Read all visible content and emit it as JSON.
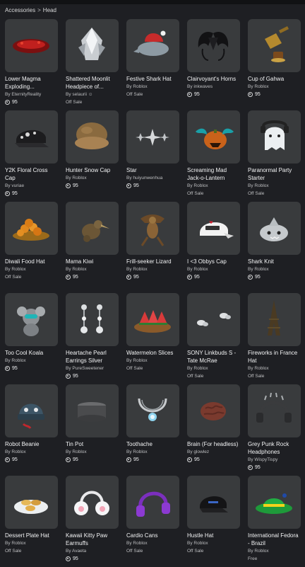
{
  "breadcrumb": {
    "root": "Accessories",
    "separator": ">",
    "current": "Head"
  },
  "items": [
    {
      "name": "Lower Magma Exploding...",
      "creator_prefix": "By",
      "creator": "EternityReality",
      "price": "95",
      "offsale": "",
      "icon": "magma-icon"
    },
    {
      "name": "Shattered Moonlit Headpiece of...",
      "creator_prefix": "By",
      "creator": "selaurii ☺",
      "price": "",
      "offsale": "Off Sale",
      "icon": "crystal-headpiece-icon"
    },
    {
      "name": "Festive Shark Hat",
      "creator_prefix": "By",
      "creator": "Roblox",
      "price": "",
      "offsale": "Off Sale",
      "icon": "shark-hat-icon"
    },
    {
      "name": "Clairvoyant's Horns",
      "creator_prefix": "By",
      "creator": "inkwaves",
      "price": "95",
      "offsale": "",
      "icon": "horns-icon"
    },
    {
      "name": "Cup of Gahwa",
      "creator_prefix": "By",
      "creator": "Roblox",
      "price": "95",
      "offsale": "",
      "icon": "coffee-pot-icon"
    },
    {
      "name": "Y2K Floral Cross Cap",
      "creator_prefix": "By",
      "creator": "vuriae",
      "price": "95",
      "offsale": "",
      "icon": "cap-icon"
    },
    {
      "name": "Hunter Snow Cap",
      "creator_prefix": "By",
      "creator": "Roblox",
      "price": "95",
      "offsale": "",
      "icon": "fur-hat-icon"
    },
    {
      "name": "Star",
      "creator_prefix": "By",
      "creator": "huiyunwenhua",
      "price": "95",
      "offsale": "",
      "icon": "star-icon"
    },
    {
      "name": "Screaming Mad Jack-o-Lantern",
      "creator_prefix": "By",
      "creator": "Roblox",
      "price": "",
      "offsale": "Off Sale",
      "icon": "pumpkin-icon"
    },
    {
      "name": "Paranormal Party Starter",
      "creator_prefix": "By",
      "creator": "Roblox",
      "price": "",
      "offsale": "Off Sale",
      "icon": "ghost-icon"
    },
    {
      "name": "Diwali Food Hat",
      "creator_prefix": "By",
      "creator": "Roblox",
      "price": "",
      "offsale": "Off Sale",
      "icon": "food-plate-icon"
    },
    {
      "name": "Mama Kiwi",
      "creator_prefix": "By",
      "creator": "Roblox",
      "price": "95",
      "offsale": "",
      "icon": "kiwi-bird-icon"
    },
    {
      "name": "Frill-seeker Lizard",
      "creator_prefix": "By",
      "creator": "Roblox",
      "price": "95",
      "offsale": "",
      "icon": "lizard-icon"
    },
    {
      "name": "I <3 Obbys Cap",
      "creator_prefix": "By",
      "creator": "Roblox",
      "price": "95",
      "offsale": "",
      "icon": "obby-cap-icon"
    },
    {
      "name": "Shark Knit",
      "creator_prefix": "By",
      "creator": "Roblox",
      "price": "95",
      "offsale": "",
      "icon": "shark-knit-icon"
    },
    {
      "name": "Too Cool Koala",
      "creator_prefix": "By",
      "creator": "Roblox",
      "price": "95",
      "offsale": "",
      "icon": "koala-icon"
    },
    {
      "name": "Heartache Pearl Earrings Silver",
      "creator_prefix": "By",
      "creator": "PureSweetener",
      "price": "95",
      "offsale": "",
      "icon": "earrings-icon"
    },
    {
      "name": "Watermelon Slices",
      "creator_prefix": "By",
      "creator": "Roblox",
      "price": "",
      "offsale": "Off Sale",
      "icon": "watermelon-icon"
    },
    {
      "name": "SONY Linkbuds S - Tate McRae",
      "creator_prefix": "By",
      "creator": "Roblox",
      "price": "",
      "offsale": "Off Sale",
      "icon": "earbuds-icon"
    },
    {
      "name": "Fireworks in France Hat",
      "creator_prefix": "By",
      "creator": "Roblox",
      "price": "",
      "offsale": "Off Sale",
      "icon": "eiffel-tower-icon"
    },
    {
      "name": "Robot Beanie",
      "creator_prefix": "By",
      "creator": "Roblox",
      "price": "95",
      "offsale": "",
      "icon": "robot-beanie-icon"
    },
    {
      "name": "Tin Pot",
      "creator_prefix": "By",
      "creator": "Roblox",
      "price": "95",
      "offsale": "",
      "icon": "tin-pot-icon"
    },
    {
      "name": "Toothache",
      "creator_prefix": "By",
      "creator": "Roblox",
      "price": "95",
      "offsale": "",
      "icon": "tooth-necklace-icon"
    },
    {
      "name": "Brain (For headless)",
      "creator_prefix": "By",
      "creator": "glowlez",
      "price": "95",
      "offsale": "",
      "icon": "brain-icon"
    },
    {
      "name": "Grey Punk Rock Headphones",
      "creator_prefix": "By",
      "creator": "WispyTispy",
      "price": "95",
      "offsale": "",
      "icon": "headphones-icon"
    },
    {
      "name": "Dessert Plate Hat",
      "creator_prefix": "By",
      "creator": "Roblox",
      "price": "",
      "offsale": "Off Sale",
      "icon": "dessert-plate-icon"
    },
    {
      "name": "Kawaii Kitty Paw Earmuffs",
      "creator_prefix": "By",
      "creator": "Avaeta",
      "price": "95",
      "offsale": "",
      "icon": "earmuffs-icon"
    },
    {
      "name": "Cardio Cans",
      "creator_prefix": "By",
      "creator": "Roblox",
      "price": "",
      "offsale": "Off Sale",
      "icon": "purple-headphones-icon"
    },
    {
      "name": "Hustle Hat",
      "creator_prefix": "By",
      "creator": "Roblox",
      "price": "",
      "offsale": "Off Sale",
      "icon": "black-cap-icon"
    },
    {
      "name": "International Fedora - Brazil",
      "creator_prefix": "By",
      "creator": "Roblox",
      "price": "",
      "offsale": "Free",
      "icon": "fedora-icon"
    }
  ]
}
